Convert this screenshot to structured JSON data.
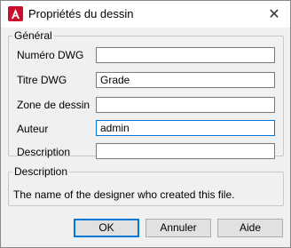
{
  "window": {
    "title": "Propriétés du dessin",
    "close_glyph": "✕"
  },
  "general": {
    "legend": "Général",
    "fields": [
      {
        "label": "Numéro DWG",
        "value": ""
      },
      {
        "label": "Titre DWG",
        "value": "Grade"
      },
      {
        "label": "Zone de dessin",
        "value": ""
      },
      {
        "label": "Auteur",
        "value": "admin"
      },
      {
        "label": "Description",
        "value": ""
      }
    ]
  },
  "description": {
    "legend": "Description",
    "text": "The name of the designer who created this file."
  },
  "buttons": {
    "ok": "OK",
    "cancel": "Annuler",
    "help": "Aide"
  },
  "colors": {
    "icon_red": "#c8102e",
    "focus_blue": "#0078d7"
  }
}
